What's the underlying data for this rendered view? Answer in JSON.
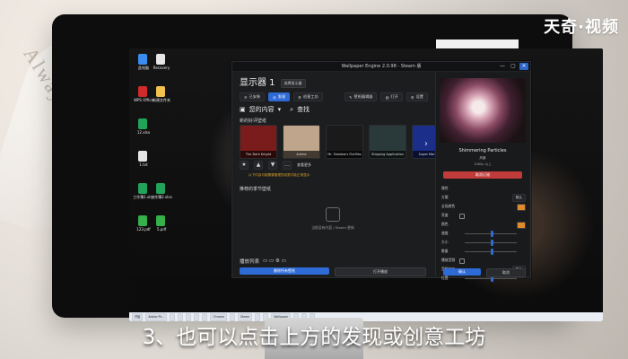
{
  "watermark": "天奇·视频",
  "subtitle": "3、也可以点击上方的发现或创意工坊",
  "desktop": {
    "icons": [
      {
        "label": "此电脑",
        "icon": "computer-icon",
        "color": "#3a8df0"
      },
      {
        "label": "Recovery",
        "icon": "app-icon",
        "color": "#e7e7e7"
      },
      {
        "label": "WPS Office",
        "icon": "wps-icon",
        "color": "#d12a2a"
      },
      {
        "label": "新建文件夹",
        "icon": "folder-icon",
        "color": "#f2c14e"
      },
      {
        "label": "12.xlsx",
        "icon": "excel-icon",
        "color": "#22a35a"
      },
      {
        "label": "1.txt",
        "icon": "txt-icon",
        "color": "#e7e7e7"
      },
      {
        "label": "工作簿1.xlsx",
        "icon": "excel-icon",
        "color": "#22a35a"
      },
      {
        "label": "123.pdf",
        "icon": "pdf-icon",
        "color": "#35b04a"
      },
      {
        "label": "工作簿2.xlsx",
        "icon": "excel-icon",
        "color": "#22a35a"
      },
      {
        "label": "5.pdf",
        "icon": "pdf-icon",
        "color": "#35b04a"
      }
    ]
  },
  "window": {
    "title": "Wallpaper Engine 2.0.98 - Steam 版",
    "left": {
      "header_title": "显示器 1",
      "chip": "选择显示器",
      "toolbar": {
        "left": [
          {
            "label": "已安装",
            "active": false,
            "icon": "list-icon"
          },
          {
            "label": "发现",
            "active": true,
            "icon": "compass-icon"
          },
          {
            "label": "创意工坊",
            "active": false,
            "icon": "workshop-icon"
          }
        ],
        "right": [
          {
            "label": "壁纸编辑器",
            "icon": "edit-icon"
          },
          {
            "label": "打开",
            "icon": "folder-open-icon"
          },
          {
            "label": "设置",
            "icon": "gear-icon"
          }
        ]
      },
      "section_buttons": [
        {
          "label": "您的内容",
          "icon": "image-icon"
        },
        {
          "label": "查找",
          "icon": "search-icon"
        }
      ],
      "featured_title": "新的好评壁纸",
      "cards": [
        {
          "caption": "The Dark Knight",
          "bg": "#7a1c1c"
        },
        {
          "caption": "Anime",
          "bg": "#bfa58c"
        },
        {
          "caption": "Mr. Shadow's Fireflies",
          "bg": "#1a1a1a"
        },
        {
          "caption": "Shipping Application",
          "bg": "#2a3a3a"
        },
        {
          "caption": "Super Mario 64",
          "bg": "#1b2f8a"
        }
      ],
      "actions_text": "查看更多",
      "warning": "以下内容可能需要管理员权限才能正常显示",
      "section2_title": "推荐的季节壁纸",
      "empty_text": "当前没有内容 / Steam 更新",
      "playlist_title": "播放列表",
      "playlist_buttons": [
        {
          "label": "删除所有壁纸",
          "primary": true
        },
        {
          "label": "打开播放",
          "primary": false
        }
      ]
    },
    "right": {
      "preview_name": "Shimmering Particles",
      "meta1": "风景",
      "meta2": "1080p 以上",
      "unsubscribe": "取消订阅",
      "properties": [
        {
          "label": "属性",
          "type": "header"
        },
        {
          "label": "方案",
          "type": "select",
          "value": "默认"
        },
        {
          "label": "全局颜色",
          "type": "color"
        },
        {
          "label": "亮度",
          "type": "checkbox"
        },
        {
          "label": "颜色",
          "type": "color"
        },
        {
          "label": "速度",
          "type": "slider"
        },
        {
          "label": "大小",
          "type": "slider"
        },
        {
          "label": "数量",
          "type": "slider"
        },
        {
          "label": "播放音频",
          "type": "checkbox"
        },
        {
          "label": "音频响应",
          "type": "select",
          "value": "默认"
        },
        {
          "label": "位置",
          "type": "slider"
        }
      ],
      "buttons": [
        {
          "label": "确认",
          "primary": true
        },
        {
          "label": "取消",
          "primary": false
        }
      ]
    }
  },
  "taskbar": {
    "items": [
      "开始",
      "Adobe Ph...",
      "",
      "",
      "",
      "",
      "",
      "Chrome",
      "",
      "Steam",
      "",
      "",
      "Wallpaper",
      "",
      "",
      ""
    ]
  }
}
